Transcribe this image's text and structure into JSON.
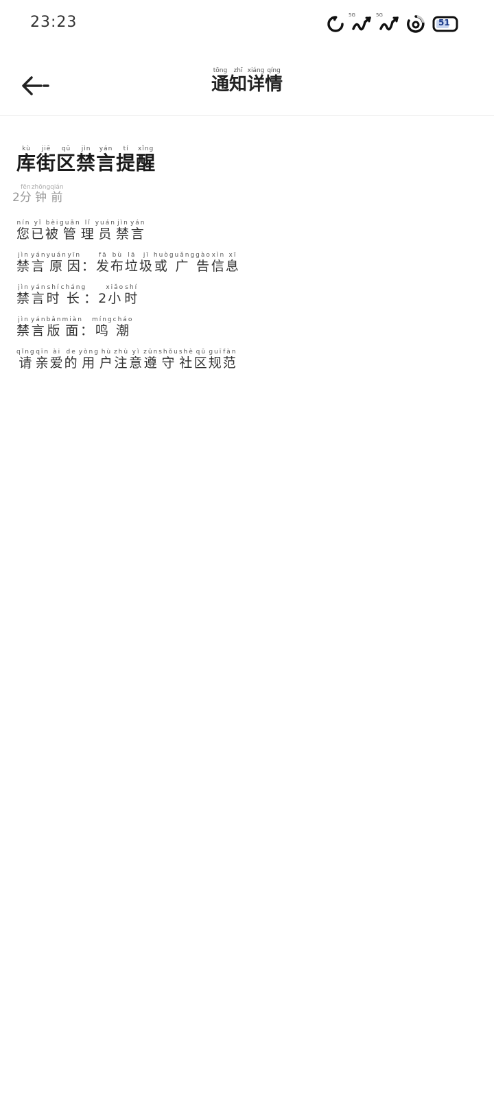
{
  "status_bar": {
    "time": "23:23",
    "signal_label_1": "5G",
    "signal_label_2": "5G",
    "battery_level": "51",
    "icons": [
      "notification-icon",
      "signal-5g-icon",
      "signal-5g-icon",
      "loading-icon",
      "battery-icon"
    ]
  },
  "header": {
    "back_icon": "arrow-left-icon",
    "title_chars": [
      "通",
      "知",
      "详",
      "情"
    ],
    "title_pinyin": [
      "tōng",
      "zhī",
      "xiáng",
      "qíng"
    ]
  },
  "notice": {
    "title_chars": [
      "库",
      "街",
      "区",
      "禁",
      "言",
      "提",
      "醒"
    ],
    "title_pinyin": [
      "kù",
      "jiē",
      "qū",
      "jìn",
      "yán",
      "tí",
      "xǐng"
    ],
    "time_number": "2",
    "time_chars": [
      "分",
      "钟",
      "前"
    ],
    "time_pinyin": [
      "fēn",
      "zhōng",
      "qián"
    ],
    "line1_chars": [
      "您",
      "已",
      "被",
      "管",
      "理",
      "员",
      "禁",
      "言"
    ],
    "line1_pinyin": [
      "nín",
      "yǐ",
      "bèi",
      "guǎn",
      "lǐ",
      "yuán",
      "jìn",
      "yán"
    ],
    "line2_label_chars": [
      "禁",
      "言",
      "原",
      "因"
    ],
    "line2_label_pinyin": [
      "jìn",
      "yán",
      "yuán",
      "yīn"
    ],
    "line2_value_chars": [
      "发",
      "布",
      "垃",
      "圾",
      "或",
      "广",
      "告",
      "信",
      "息"
    ],
    "line2_value_pinyin": [
      "fā",
      "bù",
      "lā",
      "jī",
      "huò",
      "guǎng",
      "gào",
      "xìn",
      "xī"
    ],
    "line3_label_chars": [
      "禁",
      "言",
      "时",
      "长"
    ],
    "line3_label_pinyin": [
      "jìn",
      "yán",
      "shí",
      "cháng"
    ],
    "line3_value_number": "2",
    "line3_value_chars": [
      "小",
      "时"
    ],
    "line3_value_pinyin": [
      "xiǎo",
      "shí"
    ],
    "line4_label_chars": [
      "禁",
      "言",
      "版",
      "面"
    ],
    "line4_label_pinyin": [
      "jìn",
      "yán",
      "bǎn",
      "miàn"
    ],
    "line4_value_chars": [
      "鸣",
      "潮"
    ],
    "line4_value_pinyin": [
      "míng",
      "cháo"
    ],
    "line5_chars": [
      "请",
      "亲",
      "爱",
      "的",
      "用",
      "户",
      "注",
      "意",
      "遵",
      "守",
      "社",
      "区",
      "规",
      "范"
    ],
    "line5_pinyin": [
      "qǐng",
      "qīn",
      "ài",
      "de",
      "yòng",
      "hù",
      "zhù",
      "yì",
      "zūn",
      "shǒu",
      "shè",
      "qū",
      "guī",
      "fàn"
    ],
    "colon": "："
  }
}
